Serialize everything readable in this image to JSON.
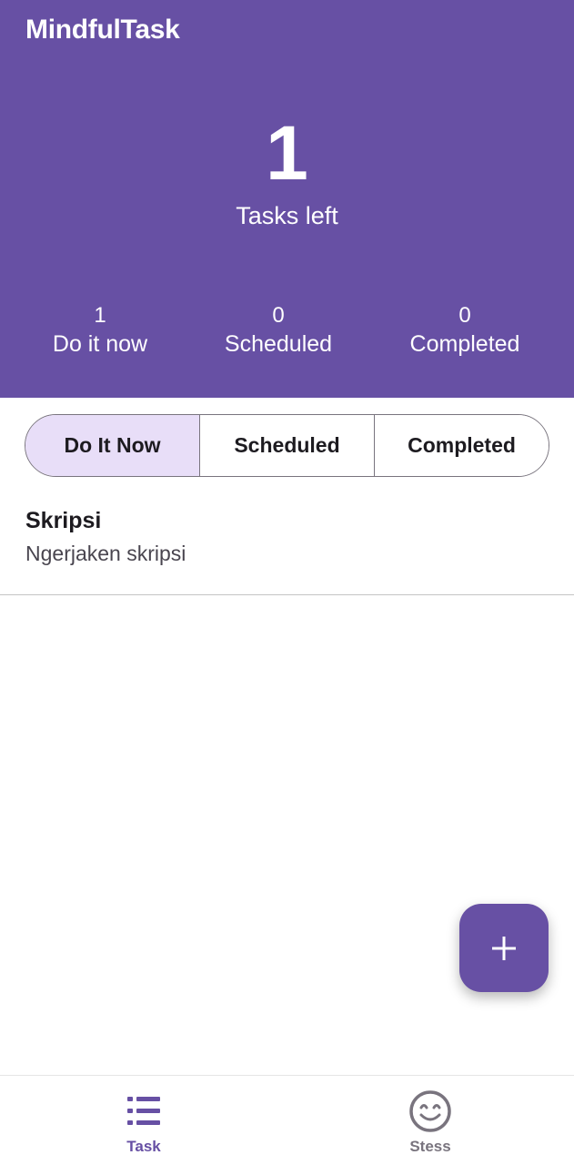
{
  "app": {
    "title": "MindfulTask"
  },
  "summary": {
    "count": "1",
    "label": "Tasks left",
    "stats": [
      {
        "value": "1",
        "label": "Do it now"
      },
      {
        "value": "0",
        "label": "Scheduled"
      },
      {
        "value": "0",
        "label": "Completed"
      }
    ]
  },
  "tabs": [
    {
      "label": "Do It Now",
      "selected": true
    },
    {
      "label": "Scheduled",
      "selected": false
    },
    {
      "label": "Completed",
      "selected": false
    }
  ],
  "tasks": [
    {
      "title": "Skripsi",
      "description": "Ngerjaken skripsi"
    }
  ],
  "fab": {
    "icon": "plus-icon"
  },
  "bottom_nav": [
    {
      "label": "Task",
      "icon": "list-icon",
      "active": true
    },
    {
      "label": "Stess",
      "icon": "smiley-icon",
      "active": false
    }
  ],
  "colors": {
    "primary": "#6750A4",
    "tab_selected_bg": "#E8DEF8",
    "outline": "#79747E"
  }
}
